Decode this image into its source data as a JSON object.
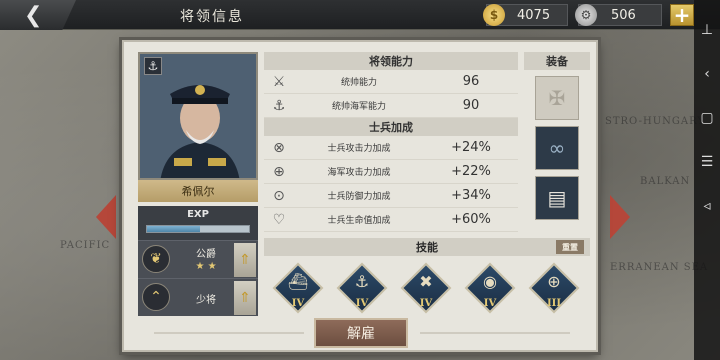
{
  "header": {
    "title": "将领信息"
  },
  "currencies": [
    {
      "name": "gold",
      "value": "4075",
      "icon": "gold-coin-icon"
    },
    {
      "name": "silver",
      "value": "506",
      "icon": "silver-coin-icon"
    }
  ],
  "map_labels": {
    "pacific": "PACIFIC",
    "austria": "STRO-HUNGARY",
    "balkans": "BALKAN",
    "med": "ERRANEAN SEA"
  },
  "general": {
    "name": "希佩尔",
    "exp_label": "EXP",
    "exp_fraction": 0.52,
    "title_rank": "公爵",
    "title_stars": "★ ★",
    "military_rank": "少将"
  },
  "abilities": {
    "heading": "将领能力",
    "items": [
      {
        "icon": "crossed-swords-icon",
        "label": "统帅能力",
        "value": "96"
      },
      {
        "icon": "anchor-icon",
        "label": "统帅海军能力",
        "value": "90"
      }
    ]
  },
  "bonuses": {
    "heading": "士兵加成",
    "items": [
      {
        "icon": "attack-icon",
        "label": "士兵攻击力加成",
        "value": "+24%"
      },
      {
        "icon": "naval-attack-icon",
        "label": "海军攻击力加成",
        "value": "+22%"
      },
      {
        "icon": "defense-icon",
        "label": "士兵防御力加成",
        "value": "+34%"
      },
      {
        "icon": "health-icon",
        "label": "士兵生命值加成",
        "value": "+60%"
      }
    ]
  },
  "equipment": {
    "heading": "装备"
  },
  "skills": {
    "heading": "技能",
    "reset_label": "重置",
    "items": [
      {
        "icon": "battleship-icon",
        "level": "IV"
      },
      {
        "icon": "anchor-skill-icon",
        "level": "IV"
      },
      {
        "icon": "artillery-icon",
        "level": "IV"
      },
      {
        "icon": "eye-icon",
        "level": "IV"
      },
      {
        "icon": "crosshair-icon",
        "level": "III"
      }
    ]
  },
  "dismiss_label": "解雇",
  "colors": {
    "accent_gold": "#e3c874",
    "dialog_bg": "#e7e5dd",
    "dismiss": "#7a5a4a"
  }
}
